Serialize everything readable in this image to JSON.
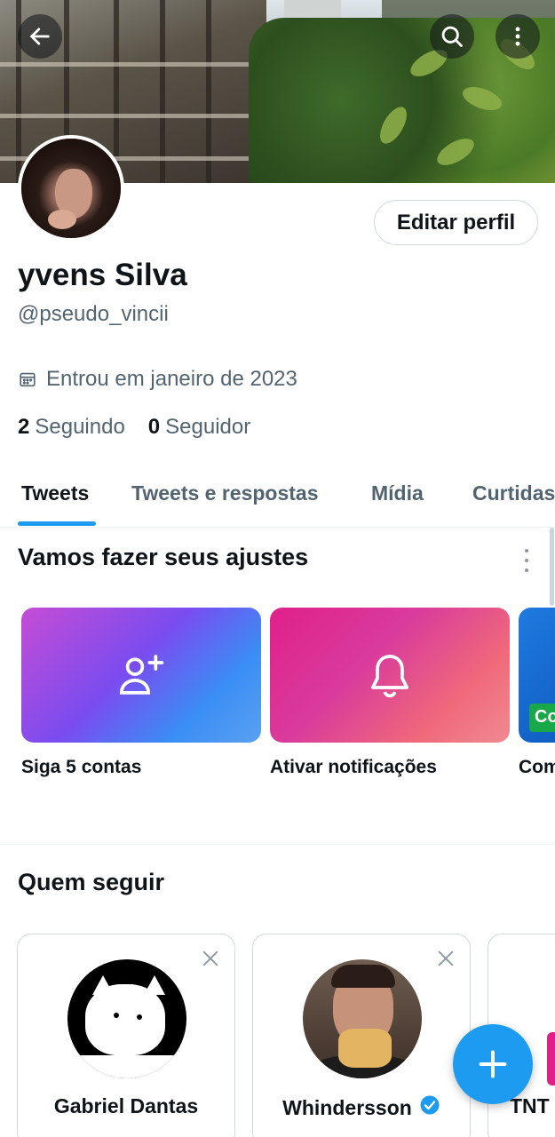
{
  "profile": {
    "name": "yvens Silva",
    "handle": "@pseudo_vincii",
    "joined": "Entrou em janeiro de 2023",
    "following_count": "2",
    "following_label": "Seguindo",
    "followers_count": "0",
    "followers_label": "Seguidor",
    "edit_label": "Editar perfil"
  },
  "tabs": [
    {
      "label": "Tweets",
      "active": true
    },
    {
      "label": "Tweets e respostas",
      "active": false
    },
    {
      "label": "Mídia",
      "active": false
    },
    {
      "label": "Curtidas",
      "active": false
    }
  ],
  "setup": {
    "title": "Vamos fazer seus ajustes",
    "cards": [
      {
        "label": "Siga 5 contas",
        "icon": "add-user-icon"
      },
      {
        "label": "Ativar notificações",
        "icon": "bell-icon"
      },
      {
        "label": "Com",
        "badge": "Co"
      }
    ]
  },
  "who_to_follow": {
    "title": "Quem seguir",
    "accounts": [
      {
        "name": "Gabriel Dantas",
        "verified": false
      },
      {
        "name": "Whindersson",
        "verified": true
      },
      {
        "name": "TNT",
        "verified": false
      }
    ]
  },
  "colors": {
    "accent": "#1d9bf0",
    "text": "#0f1419",
    "muted": "#536471",
    "border": "#cfd9de"
  },
  "icons": {
    "back": "arrow-left-icon",
    "search": "search-icon",
    "more": "more-vertical-icon",
    "calendar": "calendar-icon",
    "close": "close-icon",
    "verified": "verified-badge-icon",
    "compose": "plus-icon"
  }
}
